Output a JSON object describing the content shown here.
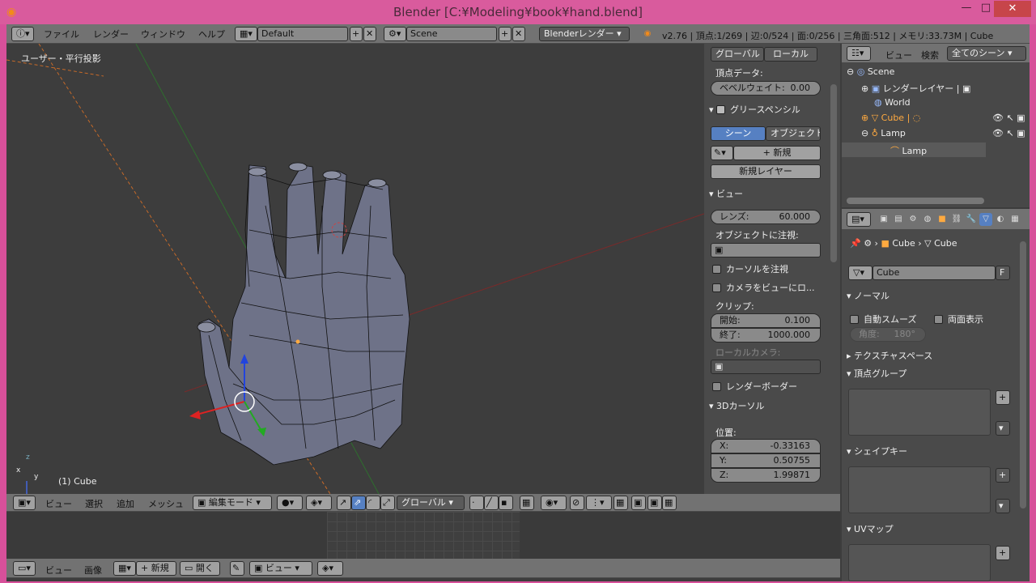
{
  "window": {
    "title": "Blender [C:¥Modeling¥book¥hand.blend]",
    "min": "—",
    "max": "□",
    "close": "✕"
  },
  "topbar": {
    "menus": [
      "ファイル",
      "レンダー",
      "ウィンドウ",
      "ヘルプ"
    ],
    "layout": "Default",
    "scene": "Scene",
    "engine": "Blenderレンダー",
    "stats": "v2.76 | 頂点:1/269 | 辺:0/524 | 面:0/256 | 三角面:512 | メモリ:33.73M | Cube"
  },
  "viewport": {
    "view_label": "ユーザー・平行投影",
    "object_label": "(1) Cube",
    "axis_x": "x",
    "axis_y": "y",
    "axis_z": "z"
  },
  "npanel": {
    "tabs": [
      "グローバル",
      "ローカル"
    ],
    "vertex_data": "頂点データ:",
    "bevel_weight_label": "ベベルウェイト:",
    "bevel_weight": "0.00",
    "grease_pencil": "グリースペンシル",
    "gp_tabs": [
      "シーン",
      "オブジェクト"
    ],
    "gp_new": "新規",
    "gp_new_layer": "新規レイヤー",
    "view": "ビュー",
    "lens_label": "レンズ:",
    "lens": "60.000",
    "lock_object": "オブジェクトに注視:",
    "lock_cursor": "カーソルを注視",
    "lock_camera": "カメラをビューにロ...",
    "clip": "クリップ:",
    "clip_start_label": "開始:",
    "clip_start": "0.100",
    "clip_end_label": "終了:",
    "clip_end": "1000.000",
    "local_camera": "ローカルカメラ:",
    "render_border": "レンダーボーダー",
    "cursor": "3Dカーソル",
    "location": "位置:",
    "cx_label": "X:",
    "cx": "-0.33163",
    "cy_label": "Y:",
    "cy": "0.50755",
    "cz_label": "Z:",
    "cz": "1.99871"
  },
  "v3dheader": {
    "menus": [
      "ビュー",
      "選択",
      "追加",
      "メッシュ"
    ],
    "mode": "編集モード",
    "orientation": "グローバル"
  },
  "timeline": {
    "menus": [
      "ビュー",
      "画像"
    ],
    "new": "新規",
    "open": "開く",
    "view": "ビュー"
  },
  "outliner": {
    "menus": [
      "ビュー",
      "検索"
    ],
    "filter": "全てのシーン",
    "items": [
      {
        "label": "Scene",
        "indent": 0
      },
      {
        "label": "レンダーレイヤー",
        "indent": 1
      },
      {
        "label": "World",
        "indent": 1
      },
      {
        "label": "Cube",
        "indent": 1
      },
      {
        "label": "Lamp",
        "indent": 1
      },
      {
        "label": "Lamp",
        "indent": 2
      }
    ]
  },
  "props": {
    "breadcrumb": [
      "Cube",
      "Cube"
    ],
    "mesh_name": "Cube",
    "fake_user": "F",
    "normals": "ノーマル",
    "auto_smooth": "自動スムーズ",
    "double_sided": "両面表示",
    "angle_label": "角度:",
    "angle": "180°",
    "texture_space": "テクスチャスペース",
    "vertex_groups": "頂点グループ",
    "shape_keys": "シェイプキー",
    "uv_maps": "UVマップ"
  },
  "colors": {
    "accent": "#5680c2",
    "selected": "#ffaa40",
    "bg": "#3d3d3d"
  }
}
